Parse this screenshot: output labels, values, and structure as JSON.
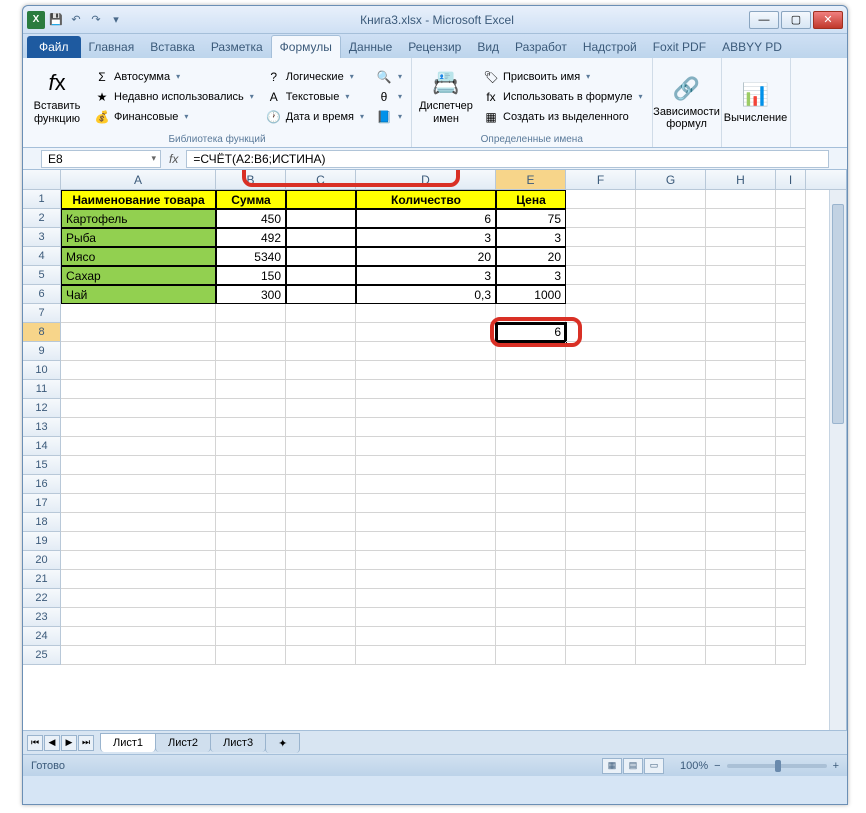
{
  "title": "Книга3.xlsx - Microsoft Excel",
  "tabs": {
    "file": "Файл",
    "home": "Главная",
    "insert": "Вставка",
    "layout": "Разметка",
    "formulas": "Формулы",
    "data": "Данные",
    "review": "Рецензир",
    "view": "Вид",
    "dev": "Разработ",
    "addins": "Надстрой",
    "foxit": "Foxit PDF",
    "abbyy": "ABBYY PD"
  },
  "ribbon": {
    "insert_fn": "Вставить функцию",
    "autosum": "Автосумма",
    "recent": "Недавно использовались",
    "financial": "Финансовые",
    "logical": "Логические",
    "text": "Текстовые",
    "datetime": "Дата и время",
    "lib_label": "Библиотека функций",
    "name_mgr": "Диспетчер имен",
    "assign": "Присвоить имя",
    "use_in": "Использовать в формуле",
    "create_from": "Создать из выделенного",
    "names_label": "Определенные имена",
    "deps": "Зависимости формул",
    "calc": "Вычисление"
  },
  "namebox": "E8",
  "formula": "=СЧЁТ(A2:B6;ИСТИНА)",
  "cols": [
    "A",
    "B",
    "C",
    "D",
    "E",
    "F",
    "G",
    "H",
    "I"
  ],
  "headers": {
    "a": "Наименование товара",
    "b": "Сумма",
    "d": "Количество",
    "e": "Цена"
  },
  "data": [
    {
      "a": "Картофель",
      "b": "450",
      "d": "6",
      "e": "75"
    },
    {
      "a": "Рыба",
      "b": "492",
      "d": "3",
      "e": "3"
    },
    {
      "a": "Мясо",
      "b": "5340",
      "d": "20",
      "e": "20"
    },
    {
      "a": "Сахар",
      "b": "150",
      "d": "3",
      "e": "3"
    },
    {
      "a": "Чай",
      "b": "300",
      "d": "0,3",
      "e": "1000"
    }
  ],
  "result": "6",
  "sheets": {
    "s1": "Лист1",
    "s2": "Лист2",
    "s3": "Лист3"
  },
  "status": "Готово",
  "zoom": "100%"
}
